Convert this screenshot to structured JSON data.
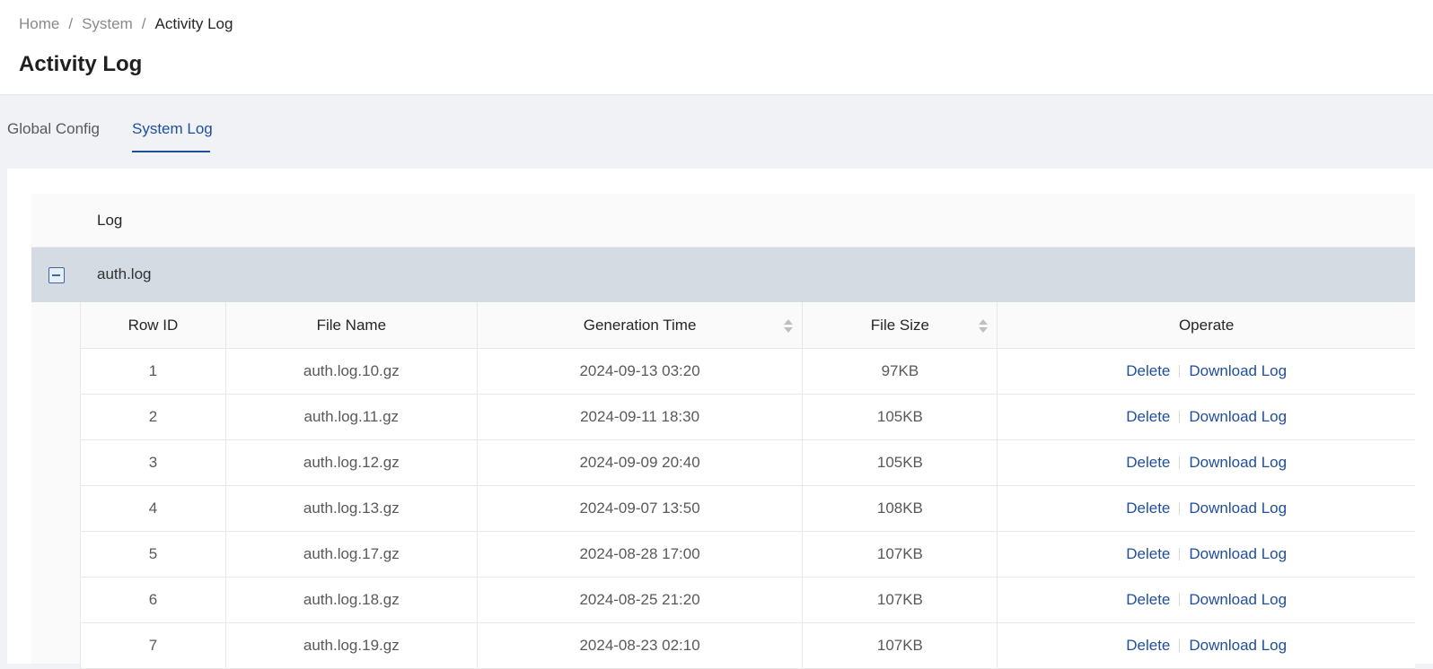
{
  "breadcrumb": [
    "Home",
    "System",
    "Activity Log"
  ],
  "breadcrumb_separator": "/",
  "page": {
    "title": "Activity Log"
  },
  "tabs": [
    {
      "label": "Global Config",
      "active": false
    },
    {
      "label": "System Log",
      "active": true
    }
  ],
  "outer_table": {
    "header": "Log",
    "group": {
      "label": "auth.log",
      "expanded": true
    }
  },
  "inner_table": {
    "columns": [
      "Row ID",
      "File Name",
      "Generation Time",
      "File Size",
      "Operate"
    ],
    "sortable_columns": [
      "Generation Time",
      "File Size"
    ],
    "rows": [
      {
        "id": "1",
        "file": "auth.log.10.gz",
        "time": "2024-09-13 03:20",
        "size": "97KB"
      },
      {
        "id": "2",
        "file": "auth.log.11.gz",
        "time": "2024-09-11 18:30",
        "size": "105KB"
      },
      {
        "id": "3",
        "file": "auth.log.12.gz",
        "time": "2024-09-09 20:40",
        "size": "105KB"
      },
      {
        "id": "4",
        "file": "auth.log.13.gz",
        "time": "2024-09-07 13:50",
        "size": "108KB"
      },
      {
        "id": "5",
        "file": "auth.log.17.gz",
        "time": "2024-08-28 17:00",
        "size": "107KB"
      },
      {
        "id": "6",
        "file": "auth.log.18.gz",
        "time": "2024-08-25 21:20",
        "size": "107KB"
      },
      {
        "id": "7",
        "file": "auth.log.19.gz",
        "time": "2024-08-23 02:10",
        "size": "107KB"
      }
    ],
    "actions": {
      "delete": "Delete",
      "download": "Download Log"
    }
  },
  "icons": {
    "expand": "collapse-minus-icon",
    "sort": "sort-caret-icon"
  },
  "colors": {
    "accent": "#1f4e9c",
    "group_row": "#d4dbe3",
    "background": "#f0f2f5"
  }
}
